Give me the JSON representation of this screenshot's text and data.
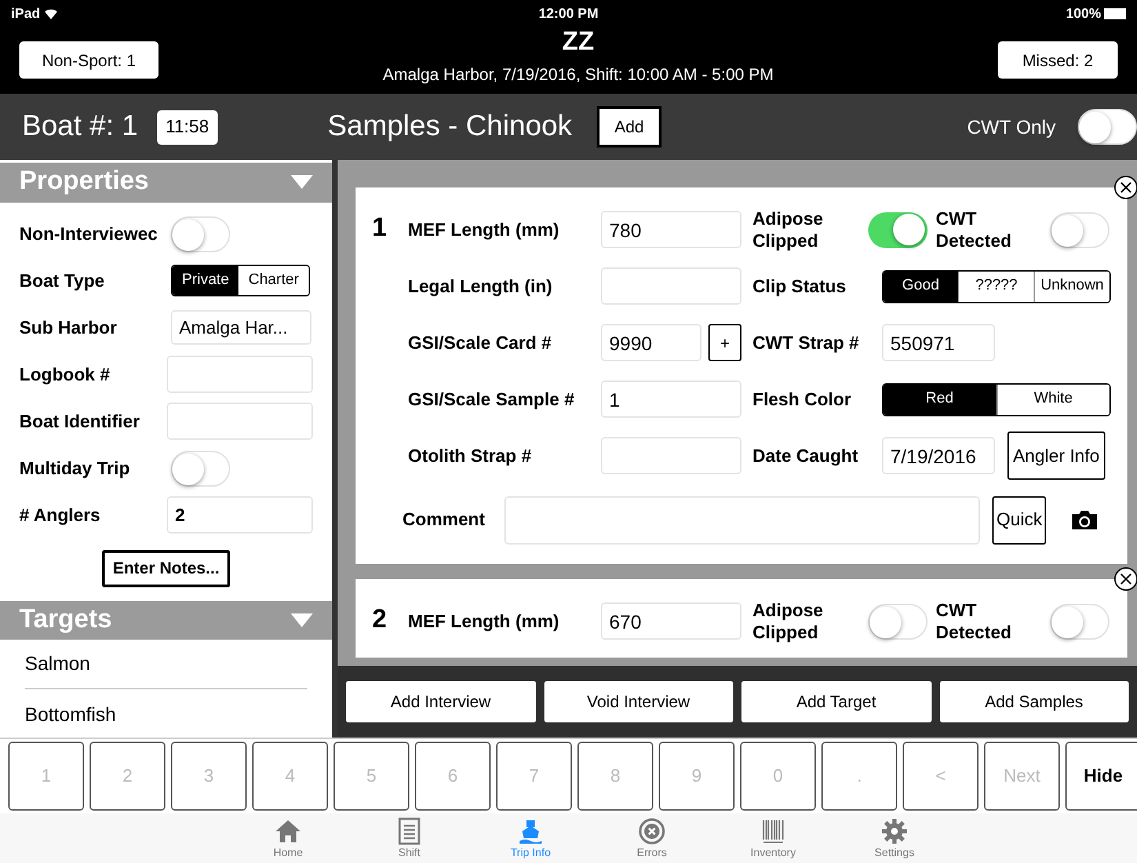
{
  "status_bar": {
    "carrier": "iPad",
    "time": "12:00 PM",
    "battery": "100%"
  },
  "header": {
    "title": "ZZ",
    "subtitle": "Amalga Harbor, 7/19/2016, Shift: 10:00 AM - 5:00 PM",
    "left_button": "Non-Sport: 1",
    "right_button": "Missed: 2"
  },
  "toolbar": {
    "boat_label": "Boat #: 1",
    "boat_time": "11:58",
    "samples_title": "Samples - Chinook",
    "add_button": "Add",
    "cwt_only": {
      "label": "CWT Only",
      "on": false
    }
  },
  "properties": {
    "title": "Properties",
    "expanded": true,
    "rows": [
      {
        "kind": "toggle",
        "label": "Non-Interviewec",
        "on": false
      },
      {
        "kind": "segmented",
        "label": "Boat Type",
        "options": [
          {
            "label": "Private",
            "selected": true
          },
          {
            "label": "Charter",
            "selected": false
          }
        ]
      },
      {
        "kind": "picker",
        "label": "Sub Harbor",
        "value": "Amalga Har..."
      },
      {
        "kind": "field",
        "label": "Logbook #"
      },
      {
        "kind": "field",
        "label": "Boat Identifier"
      },
      {
        "kind": "toggle",
        "label": "Multiday Trip",
        "on": false
      },
      {
        "kind": "field",
        "label": "# Anglers",
        "value": "2"
      }
    ],
    "notes_button": "Enter Notes..."
  },
  "targets": {
    "title": "Targets",
    "expanded": true,
    "items": [
      "Salmon",
      "Bottomfish"
    ]
  },
  "samples": [
    {
      "number": "1",
      "rows": [
        {
          "left": {
            "kind": "field",
            "label": "MEF Length (mm)",
            "value": "780"
          },
          "right": [
            {
              "kind": "toggle",
              "label": "Adipose Clipped",
              "on": true
            },
            {
              "kind": "toggle",
              "label": "CWT Detected",
              "on": false
            }
          ]
        },
        {
          "left": {
            "kind": "field",
            "label": "Legal Length (in)"
          },
          "right": [
            {
              "kind": "segmented",
              "label": "Clip Status",
              "options": [
                {
                  "label": "Good",
                  "selected": true
                },
                {
                  "label": "?????",
                  "selected": false
                },
                {
                  "label": "Unknown",
                  "selected": false
                }
              ]
            }
          ]
        },
        {
          "left": {
            "kind": "field_plus",
            "label": "GSI/Scale Card #",
            "value": "9990",
            "button": "+"
          },
          "right": [
            {
              "kind": "field",
              "label": "CWT Strap #",
              "value": "550971"
            }
          ]
        },
        {
          "left": {
            "kind": "field",
            "label": "GSI/Scale Sample #",
            "value": "1"
          },
          "right": [
            {
              "kind": "segmented",
              "label": "Flesh Color",
              "options": [
                {
                  "label": "Red",
                  "selected": true
                },
                {
                  "label": "White",
                  "selected": false
                }
              ]
            }
          ]
        },
        {
          "left": {
            "kind": "field",
            "label": "Otolith Strap #"
          },
          "right": [
            {
              "kind": "field_button",
              "label": "Date Caught",
              "value": "7/19/2016",
              "button": "Angler Info"
            }
          ]
        }
      ],
      "comment": {
        "label": "Comment",
        "button": "Quick"
      }
    },
    {
      "number": "2",
      "rows": [
        {
          "left": {
            "kind": "field",
            "label": "MEF Length (mm)",
            "value": "670"
          },
          "right": [
            {
              "kind": "toggle",
              "label": "Adipose Clipped",
              "on": false
            },
            {
              "kind": "toggle",
              "label": "CWT Detected",
              "on": false
            }
          ]
        }
      ]
    }
  ],
  "actions": [
    "Add Interview",
    "Void Interview",
    "Add Target",
    "Add Samples"
  ],
  "keypad": [
    {
      "label": "1",
      "disabled": true
    },
    {
      "label": "2",
      "disabled": true
    },
    {
      "label": "3",
      "disabled": true
    },
    {
      "label": "4",
      "disabled": true
    },
    {
      "label": "5",
      "disabled": true
    },
    {
      "label": "6",
      "disabled": true
    },
    {
      "label": "7",
      "disabled": true
    },
    {
      "label": "8",
      "disabled": true
    },
    {
      "label": "9",
      "disabled": true
    },
    {
      "label": "0",
      "disabled": true
    },
    {
      "label": ".",
      "disabled": true
    },
    {
      "label": "<",
      "disabled": true
    },
    {
      "label": "Next",
      "disabled": true
    },
    {
      "label": "Hide",
      "disabled": false
    }
  ],
  "tab_bar": [
    {
      "kind": "home",
      "label": "Home",
      "selected": false
    },
    {
      "kind": "list",
      "label": "Shift",
      "selected": false
    },
    {
      "kind": "boat",
      "label": "Trip Info",
      "selected": true
    },
    {
      "kind": "error",
      "label": "Errors",
      "selected": false
    },
    {
      "kind": "barcode",
      "label": "Inventory",
      "selected": false
    },
    {
      "kind": "gear",
      "label": "Settings",
      "selected": false
    }
  ]
}
